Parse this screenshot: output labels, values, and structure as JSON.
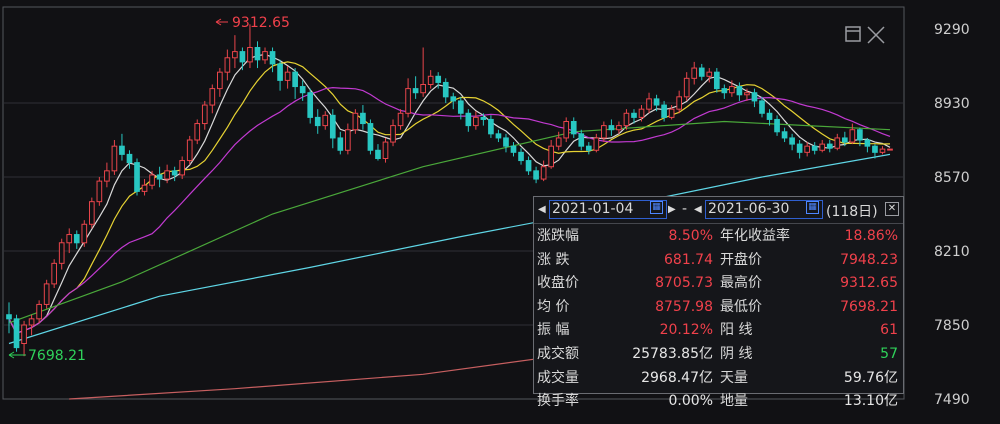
{
  "colors": {
    "background": "#111114",
    "up": "#e8454b",
    "down": "#28c7c2",
    "ma5": "#d9d9d9",
    "ma10": "#e6d233",
    "ma20": "#c23ad1",
    "ma60": "#4aa83a",
    "ma120": "#5fd6e6",
    "ma250": "#c75f60",
    "grid": "#2e3036",
    "label": "#cfcfcf"
  },
  "chart_data": {
    "type": "candlestick",
    "y_ticks": [
      "9290",
      "8930",
      "8570",
      "8210",
      "7850",
      "7490"
    ],
    "ylim": [
      7490,
      9290
    ],
    "grid": true,
    "annotations": {
      "high": "9312.65",
      "low": "7698.21"
    },
    "candles": [
      [
        7900,
        7880,
        7960,
        7810
      ],
      [
        7880,
        7740,
        7900,
        7720
      ],
      [
        7760,
        7850,
        7870,
        7698.21
      ],
      [
        7850,
        7880,
        7900,
        7800
      ],
      [
        7880,
        7950,
        7970,
        7860
      ],
      [
        7950,
        8050,
        8070,
        7930
      ],
      [
        8050,
        8150,
        8170,
        8030
      ],
      [
        8150,
        8250,
        8270,
        8120
      ],
      [
        8250,
        8290,
        8320,
        8200
      ],
      [
        8290,
        8250,
        8310,
        8220
      ],
      [
        8250,
        8340,
        8360,
        8230
      ],
      [
        8340,
        8450,
        8470,
        8320
      ],
      [
        8450,
        8550,
        8570,
        8430
      ],
      [
        8550,
        8600,
        8640,
        8520
      ],
      [
        8600,
        8720,
        8750,
        8580
      ],
      [
        8720,
        8680,
        8780,
        8650
      ],
      [
        8680,
        8640,
        8700,
        8610
      ],
      [
        8640,
        8500,
        8660,
        8480
      ],
      [
        8500,
        8530,
        8560,
        8480
      ],
      [
        8530,
        8580,
        8600,
        8510
      ],
      [
        8580,
        8560,
        8620,
        8520
      ],
      [
        8560,
        8600,
        8630,
        8540
      ],
      [
        8600,
        8580,
        8620,
        8550
      ],
      [
        8580,
        8650,
        8670,
        8560
      ],
      [
        8650,
        8750,
        8770,
        8630
      ],
      [
        8750,
        8830,
        8850,
        8730
      ],
      [
        8830,
        8920,
        8940,
        8800
      ],
      [
        8920,
        9000,
        9020,
        8880
      ],
      [
        9000,
        9080,
        9100,
        8960
      ],
      [
        9080,
        9150,
        9190,
        9040
      ],
      [
        9150,
        9180,
        9260,
        9100
      ],
      [
        9180,
        9130,
        9200,
        9090
      ],
      [
        9130,
        9200,
        9312.65,
        9100
      ],
      [
        9200,
        9140,
        9230,
        9100
      ],
      [
        9140,
        9180,
        9200,
        9120
      ],
      [
        9180,
        9120,
        9200,
        9080
      ],
      [
        9120,
        9040,
        9140,
        8990
      ],
      [
        9040,
        9080,
        9110,
        9000
      ],
      [
        9080,
        9010,
        9100,
        8950
      ],
      [
        9010,
        8980,
        9040,
        8940
      ],
      [
        8980,
        8860,
        9000,
        8830
      ],
      [
        8860,
        8820,
        8900,
        8780
      ],
      [
        8820,
        8870,
        8890,
        8800
      ],
      [
        8870,
        8760,
        8900,
        8710
      ],
      [
        8760,
        8700,
        8790,
        8680
      ],
      [
        8700,
        8800,
        8830,
        8680
      ],
      [
        8800,
        8880,
        8900,
        8780
      ],
      [
        8880,
        8830,
        8920,
        8800
      ],
      [
        8830,
        8700,
        8850,
        8680
      ],
      [
        8700,
        8660,
        8730,
        8650
      ],
      [
        8660,
        8740,
        8760,
        8640
      ],
      [
        8740,
        8820,
        8850,
        8720
      ],
      [
        8820,
        8880,
        8900,
        8800
      ],
      [
        8880,
        9000,
        9050,
        8860
      ],
      [
        9000,
        8980,
        9060,
        8950
      ],
      [
        8980,
        9020,
        9200,
        8960
      ],
      [
        9020,
        9060,
        9090,
        9000
      ],
      [
        9060,
        9030,
        9080,
        9000
      ],
      [
        9030,
        8960,
        9050,
        8930
      ],
      [
        8960,
        8940,
        8980,
        8900
      ],
      [
        8940,
        8880,
        8960,
        8850
      ],
      [
        8880,
        8820,
        8900,
        8790
      ],
      [
        8820,
        8860,
        8890,
        8800
      ],
      [
        8860,
        8850,
        8880,
        8820
      ],
      [
        8850,
        8780,
        8870,
        8760
      ],
      [
        8780,
        8760,
        8800,
        8740
      ],
      [
        8760,
        8720,
        8780,
        8690
      ],
      [
        8720,
        8690,
        8740,
        8670
      ],
      [
        8690,
        8650,
        8710,
        8630
      ],
      [
        8650,
        8600,
        8670,
        8580
      ],
      [
        8600,
        8560,
        8620,
        8540
      ],
      [
        8560,
        8620,
        8650,
        8550
      ],
      [
        8620,
        8720,
        8750,
        8610
      ],
      [
        8720,
        8760,
        8790,
        8700
      ],
      [
        8760,
        8840,
        8860,
        8740
      ],
      [
        8840,
        8780,
        8860,
        8760
      ],
      [
        8780,
        8720,
        8800,
        8700
      ],
      [
        8720,
        8700,
        8740,
        8680
      ],
      [
        8700,
        8760,
        8780,
        8690
      ],
      [
        8760,
        8820,
        8840,
        8740
      ],
      [
        8820,
        8800,
        8850,
        8770
      ],
      [
        8800,
        8820,
        8840,
        8780
      ],
      [
        8820,
        8880,
        8900,
        8800
      ],
      [
        8880,
        8860,
        8900,
        8830
      ],
      [
        8860,
        8900,
        8920,
        8840
      ],
      [
        8900,
        8950,
        8980,
        8880
      ],
      [
        8950,
        8920,
        8970,
        8890
      ],
      [
        8920,
        8860,
        8940,
        8840
      ],
      [
        8860,
        8900,
        8920,
        8850
      ],
      [
        8900,
        8960,
        8990,
        8880
      ],
      [
        8960,
        9050,
        9080,
        8940
      ],
      [
        9050,
        9100,
        9130,
        9020
      ],
      [
        9100,
        9060,
        9120,
        9040
      ],
      [
        9060,
        9080,
        9100,
        9030
      ],
      [
        9080,
        9000,
        9100,
        8980
      ],
      [
        9000,
        8980,
        9020,
        8950
      ],
      [
        8980,
        9010,
        9040,
        8960
      ],
      [
        9010,
        8970,
        9030,
        8940
      ],
      [
        8970,
        8980,
        9000,
        8940
      ],
      [
        8980,
        8940,
        9000,
        8910
      ],
      [
        8940,
        8880,
        8960,
        8860
      ],
      [
        8880,
        8850,
        8900,
        8820
      ],
      [
        8850,
        8790,
        8870,
        8770
      ],
      [
        8790,
        8760,
        8810,
        8740
      ],
      [
        8760,
        8730,
        8780,
        8700
      ],
      [
        8730,
        8690,
        8750,
        8660
      ],
      [
        8690,
        8720,
        8740,
        8670
      ],
      [
        8720,
        8700,
        8740,
        8680
      ],
      [
        8700,
        8730,
        8750,
        8690
      ],
      [
        8730,
        8710,
        8750,
        8690
      ],
      [
        8710,
        8760,
        8780,
        8700
      ],
      [
        8760,
        8740,
        8790,
        8720
      ],
      [
        8740,
        8800,
        8830,
        8730
      ],
      [
        8800,
        8750,
        8810,
        8720
      ],
      [
        8750,
        8720,
        8760,
        8690
      ],
      [
        8720,
        8690,
        8730,
        8660
      ],
      [
        8690,
        8705.73,
        8720,
        8680
      ],
      [
        8705.73,
        8705.73,
        8705.73,
        8705.73
      ]
    ],
    "ma_lines": {
      "ma120": [
        [
          0,
          7760
        ],
        [
          20,
          7990
        ],
        [
          40,
          8130
        ],
        [
          60,
          8280
        ],
        [
          80,
          8420
        ],
        [
          100,
          8570
        ],
        [
          117,
          8680
        ]
      ],
      "ma250": [
        [
          8,
          7490
        ],
        [
          30,
          7540
        ],
        [
          55,
          7610
        ],
        [
          75,
          7710
        ],
        [
          95,
          7850
        ],
        [
          110,
          7930
        ]
      ],
      "ma60": [
        [
          0,
          7860
        ],
        [
          15,
          8060
        ],
        [
          35,
          8390
        ],
        [
          55,
          8620
        ],
        [
          75,
          8790
        ],
        [
          95,
          8840
        ],
        [
          117,
          8800
        ]
      ]
    },
    "stats_panel": {
      "start_date": "2021-01-04",
      "dash": "-",
      "end_date": "2021-06-30",
      "days": "(118日)",
      "rows": [
        {
          "l1": "涨跌幅",
          "v1": "8.50%",
          "c1": "red",
          "l2": "年化收益率",
          "v2": "18.86%",
          "c2": "red"
        },
        {
          "l1": "涨  跌",
          "v1": "681.74",
          "c1": "red",
          "l2": "开盘价",
          "v2": "7948.23",
          "c2": "red"
        },
        {
          "l1": "收盘价",
          "v1": "8705.73",
          "c1": "red",
          "l2": "最高价",
          "v2": "9312.65",
          "c2": "red"
        },
        {
          "l1": "均  价",
          "v1": "8757.98",
          "c1": "red",
          "l2": "最低价",
          "v2": "7698.21",
          "c2": "red"
        },
        {
          "l1": "振  幅",
          "v1": "20.12%",
          "c1": "red",
          "l2": "阳  线",
          "v2": "61",
          "c2": "red"
        },
        {
          "l1": "成交额",
          "v1": "25783.85亿",
          "c1": "white",
          "l2": "阴  线",
          "v2": "57",
          "c2": "green"
        },
        {
          "l1": "成交量",
          "v1": "2968.47亿",
          "c1": "white",
          "l2": "天量",
          "v2": "59.76亿",
          "c2": "white"
        },
        {
          "l1": "换手率",
          "v1": "0.00%",
          "c1": "white",
          "l2": "地量",
          "v2": "13.10亿",
          "c2": "white"
        }
      ]
    }
  }
}
